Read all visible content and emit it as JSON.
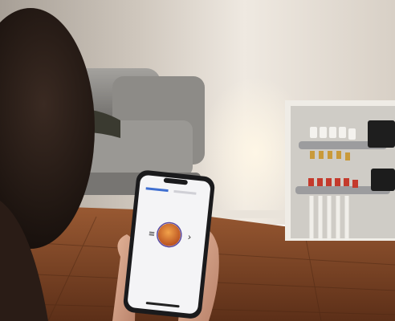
{
  "scene": {
    "description_label": "",
    "phone": {
      "app_title": "",
      "tabs": [
        "",
        ""
      ],
      "nav_left": "≡",
      "nav_right": "›"
    },
    "colors": {
      "wall": "#ded7cd",
      "floor": "#7a4527",
      "sofa": "#8c8a86",
      "phone_screen": "#f4f4f6",
      "accent": "#d97a2a"
    }
  }
}
